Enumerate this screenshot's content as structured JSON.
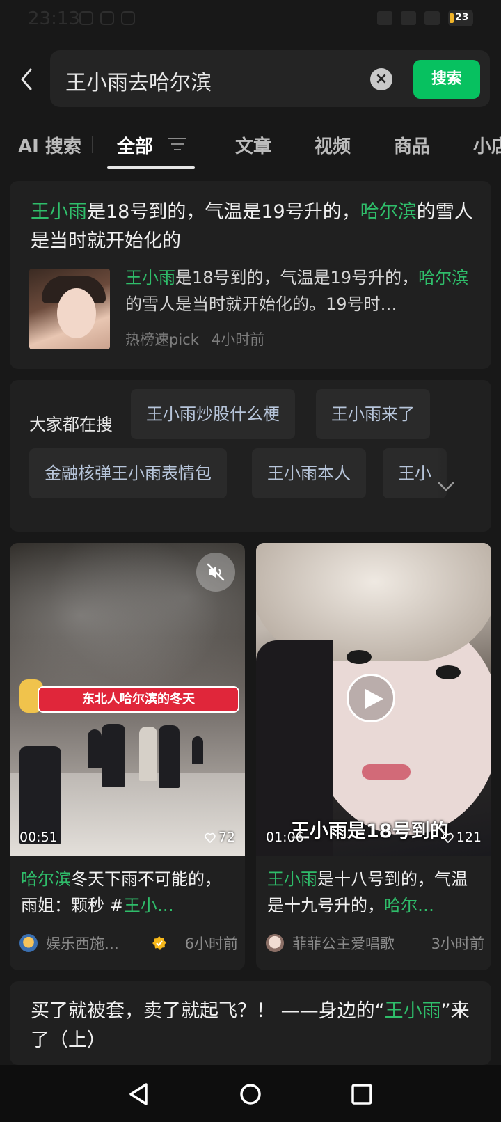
{
  "status": {
    "time": "23:13",
    "battery": "23"
  },
  "search": {
    "query": "王小雨去哈尔滨",
    "button": "搜索"
  },
  "tabs": [
    "AI 搜索",
    "全部",
    "文章",
    "视频",
    "商品",
    "小店"
  ],
  "top_result": {
    "title": [
      {
        "t": "王小雨",
        "hl": true
      },
      {
        "t": "是18号到的，气温是19号升的，",
        "hl": false
      },
      {
        "t": "哈尔滨",
        "hl": true
      },
      {
        "t": "的雪人是当时就开始化的",
        "hl": false
      }
    ],
    "snippet": [
      {
        "t": "王小雨",
        "hl": true
      },
      {
        "t": "是18号到的，气温是19号升的，",
        "hl": false
      },
      {
        "t": "哈尔滨",
        "hl": true
      },
      {
        "t": "的雪人是当时就开始化的。19号时…",
        "hl": false
      }
    ],
    "source": "热榜速pick",
    "time": "4小时前"
  },
  "trending": {
    "label": "大家都在搜",
    "row1": [
      "王小雨炒股什么梗",
      "王小雨来了"
    ],
    "row2": [
      "金融核弹王小雨表情包",
      "王小雨本人",
      "王小"
    ]
  },
  "videos": [
    {
      "banner": "东北人哈尔滨的冬天",
      "duration": "00:51",
      "likes": "72",
      "title": [
        {
          "t": "哈尔滨",
          "hl": true
        },
        {
          "t": "冬天下雨不可能的，雨姐：颗秒 #",
          "hl": false
        },
        {
          "t": "王小…",
          "hl": true
        }
      ],
      "author": "娱乐西施…",
      "time": "6小时前"
    },
    {
      "caption": "王小雨是18号到的",
      "duration": "01:06",
      "likes": "121",
      "title": [
        {
          "t": "王小雨",
          "hl": true
        },
        {
          "t": "是十八号到的，气温是十九号升的，",
          "hl": false
        },
        {
          "t": "哈尔…",
          "hl": true
        }
      ],
      "author": "菲菲公主爱唱歌",
      "time": "3小时前"
    }
  ],
  "article": {
    "title": [
      {
        "t": "买了就被套，卖了就起飞？！ ——身边的“",
        "hl": false
      },
      {
        "t": "王小雨",
        "hl": true
      },
      {
        "t": "”来了（上）",
        "hl": false
      }
    ]
  },
  "colors": {
    "accent": "#07c160",
    "highlight": "#2fbd6a",
    "background": "#181818",
    "card": "#202020"
  }
}
